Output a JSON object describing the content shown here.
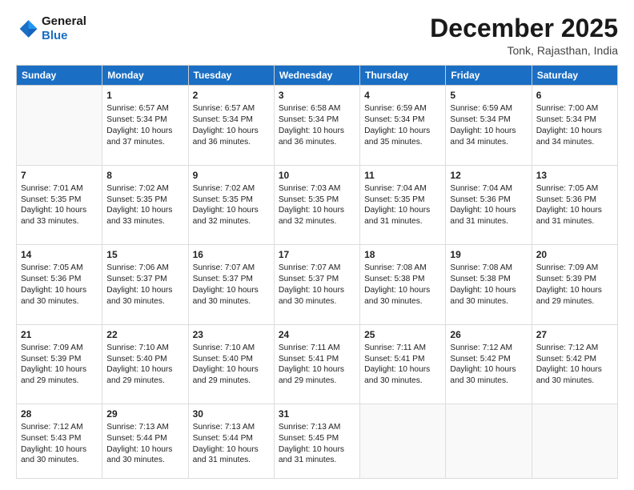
{
  "logo": {
    "line1": "General",
    "line2": "Blue"
  },
  "title": "December 2025",
  "location": "Tonk, Rajasthan, India",
  "weekdays": [
    "Sunday",
    "Monday",
    "Tuesday",
    "Wednesday",
    "Thursday",
    "Friday",
    "Saturday"
  ],
  "weeks": [
    [
      {
        "day": "",
        "sunrise": "",
        "sunset": "",
        "daylight": ""
      },
      {
        "day": "1",
        "sunrise": "Sunrise: 6:57 AM",
        "sunset": "Sunset: 5:34 PM",
        "daylight": "Daylight: 10 hours and 37 minutes."
      },
      {
        "day": "2",
        "sunrise": "Sunrise: 6:57 AM",
        "sunset": "Sunset: 5:34 PM",
        "daylight": "Daylight: 10 hours and 36 minutes."
      },
      {
        "day": "3",
        "sunrise": "Sunrise: 6:58 AM",
        "sunset": "Sunset: 5:34 PM",
        "daylight": "Daylight: 10 hours and 36 minutes."
      },
      {
        "day": "4",
        "sunrise": "Sunrise: 6:59 AM",
        "sunset": "Sunset: 5:34 PM",
        "daylight": "Daylight: 10 hours and 35 minutes."
      },
      {
        "day": "5",
        "sunrise": "Sunrise: 6:59 AM",
        "sunset": "Sunset: 5:34 PM",
        "daylight": "Daylight: 10 hours and 34 minutes."
      },
      {
        "day": "6",
        "sunrise": "Sunrise: 7:00 AM",
        "sunset": "Sunset: 5:34 PM",
        "daylight": "Daylight: 10 hours and 34 minutes."
      }
    ],
    [
      {
        "day": "7",
        "sunrise": "Sunrise: 7:01 AM",
        "sunset": "Sunset: 5:35 PM",
        "daylight": "Daylight: 10 hours and 33 minutes."
      },
      {
        "day": "8",
        "sunrise": "Sunrise: 7:02 AM",
        "sunset": "Sunset: 5:35 PM",
        "daylight": "Daylight: 10 hours and 33 minutes."
      },
      {
        "day": "9",
        "sunrise": "Sunrise: 7:02 AM",
        "sunset": "Sunset: 5:35 PM",
        "daylight": "Daylight: 10 hours and 32 minutes."
      },
      {
        "day": "10",
        "sunrise": "Sunrise: 7:03 AM",
        "sunset": "Sunset: 5:35 PM",
        "daylight": "Daylight: 10 hours and 32 minutes."
      },
      {
        "day": "11",
        "sunrise": "Sunrise: 7:04 AM",
        "sunset": "Sunset: 5:35 PM",
        "daylight": "Daylight: 10 hours and 31 minutes."
      },
      {
        "day": "12",
        "sunrise": "Sunrise: 7:04 AM",
        "sunset": "Sunset: 5:36 PM",
        "daylight": "Daylight: 10 hours and 31 minutes."
      },
      {
        "day": "13",
        "sunrise": "Sunrise: 7:05 AM",
        "sunset": "Sunset: 5:36 PM",
        "daylight": "Daylight: 10 hours and 31 minutes."
      }
    ],
    [
      {
        "day": "14",
        "sunrise": "Sunrise: 7:05 AM",
        "sunset": "Sunset: 5:36 PM",
        "daylight": "Daylight: 10 hours and 30 minutes."
      },
      {
        "day": "15",
        "sunrise": "Sunrise: 7:06 AM",
        "sunset": "Sunset: 5:37 PM",
        "daylight": "Daylight: 10 hours and 30 minutes."
      },
      {
        "day": "16",
        "sunrise": "Sunrise: 7:07 AM",
        "sunset": "Sunset: 5:37 PM",
        "daylight": "Daylight: 10 hours and 30 minutes."
      },
      {
        "day": "17",
        "sunrise": "Sunrise: 7:07 AM",
        "sunset": "Sunset: 5:37 PM",
        "daylight": "Daylight: 10 hours and 30 minutes."
      },
      {
        "day": "18",
        "sunrise": "Sunrise: 7:08 AM",
        "sunset": "Sunset: 5:38 PM",
        "daylight": "Daylight: 10 hours and 30 minutes."
      },
      {
        "day": "19",
        "sunrise": "Sunrise: 7:08 AM",
        "sunset": "Sunset: 5:38 PM",
        "daylight": "Daylight: 10 hours and 30 minutes."
      },
      {
        "day": "20",
        "sunrise": "Sunrise: 7:09 AM",
        "sunset": "Sunset: 5:39 PM",
        "daylight": "Daylight: 10 hours and 29 minutes."
      }
    ],
    [
      {
        "day": "21",
        "sunrise": "Sunrise: 7:09 AM",
        "sunset": "Sunset: 5:39 PM",
        "daylight": "Daylight: 10 hours and 29 minutes."
      },
      {
        "day": "22",
        "sunrise": "Sunrise: 7:10 AM",
        "sunset": "Sunset: 5:40 PM",
        "daylight": "Daylight: 10 hours and 29 minutes."
      },
      {
        "day": "23",
        "sunrise": "Sunrise: 7:10 AM",
        "sunset": "Sunset: 5:40 PM",
        "daylight": "Daylight: 10 hours and 29 minutes."
      },
      {
        "day": "24",
        "sunrise": "Sunrise: 7:11 AM",
        "sunset": "Sunset: 5:41 PM",
        "daylight": "Daylight: 10 hours and 29 minutes."
      },
      {
        "day": "25",
        "sunrise": "Sunrise: 7:11 AM",
        "sunset": "Sunset: 5:41 PM",
        "daylight": "Daylight: 10 hours and 30 minutes."
      },
      {
        "day": "26",
        "sunrise": "Sunrise: 7:12 AM",
        "sunset": "Sunset: 5:42 PM",
        "daylight": "Daylight: 10 hours and 30 minutes."
      },
      {
        "day": "27",
        "sunrise": "Sunrise: 7:12 AM",
        "sunset": "Sunset: 5:42 PM",
        "daylight": "Daylight: 10 hours and 30 minutes."
      }
    ],
    [
      {
        "day": "28",
        "sunrise": "Sunrise: 7:12 AM",
        "sunset": "Sunset: 5:43 PM",
        "daylight": "Daylight: 10 hours and 30 minutes."
      },
      {
        "day": "29",
        "sunrise": "Sunrise: 7:13 AM",
        "sunset": "Sunset: 5:44 PM",
        "daylight": "Daylight: 10 hours and 30 minutes."
      },
      {
        "day": "30",
        "sunrise": "Sunrise: 7:13 AM",
        "sunset": "Sunset: 5:44 PM",
        "daylight": "Daylight: 10 hours and 31 minutes."
      },
      {
        "day": "31",
        "sunrise": "Sunrise: 7:13 AM",
        "sunset": "Sunset: 5:45 PM",
        "daylight": "Daylight: 10 hours and 31 minutes."
      },
      {
        "day": "",
        "sunrise": "",
        "sunset": "",
        "daylight": ""
      },
      {
        "day": "",
        "sunrise": "",
        "sunset": "",
        "daylight": ""
      },
      {
        "day": "",
        "sunrise": "",
        "sunset": "",
        "daylight": ""
      }
    ]
  ]
}
